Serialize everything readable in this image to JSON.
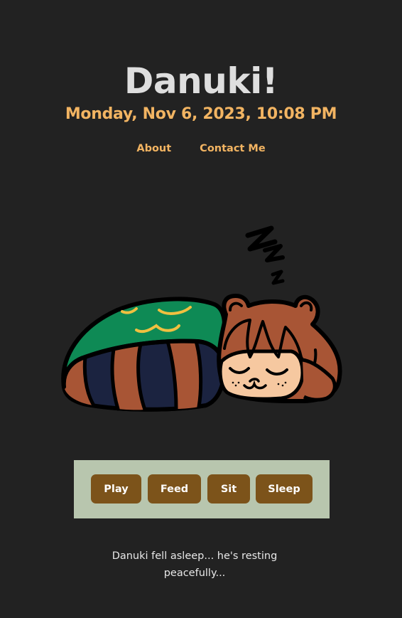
{
  "header": {
    "title": "Danuki!",
    "datetime": "Monday, Nov 6, 2023, 10:08 PM"
  },
  "nav": {
    "about_label": "About",
    "contact_label": "Contact Me"
  },
  "pet": {
    "icon": "sleeping-raccoon-icon",
    "zzz_icon": "zzz-icon"
  },
  "controls": {
    "play_label": "Play",
    "feed_label": "Feed",
    "sit_label": "Sit",
    "sleep_label": "Sleep"
  },
  "status": {
    "message": "Danuki fell asleep... he's resting peacefully..."
  },
  "colors": {
    "background": "#222222",
    "accent": "#f2b462",
    "title": "#dedede",
    "panel": "#b8c6ae",
    "button": "#7c531a"
  }
}
